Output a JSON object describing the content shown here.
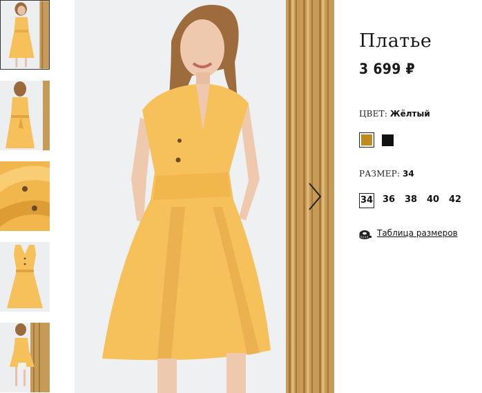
{
  "product": {
    "title": "Платье",
    "price": "3 699 ₽"
  },
  "color": {
    "label": "ЦВЕТ:",
    "selected_value": "Жёлтый",
    "swatches": [
      {
        "name": "yellow",
        "color": "#c08a1e",
        "selected": true
      },
      {
        "name": "black",
        "color": "#111111",
        "selected": false
      }
    ]
  },
  "size": {
    "label": "РАЗМЕР:",
    "selected_value": "34",
    "options": [
      "34",
      "36",
      "38",
      "40",
      "42"
    ]
  },
  "size_table": {
    "icon": "measuring-tape-icon",
    "link_text": "Таблица размеров"
  },
  "gallery": {
    "thumbnail_count": 5,
    "active_thumbnail": 1,
    "next_icon": "chevron-right-icon"
  },
  "colors": {
    "dress": "#f6c15b",
    "dress_shadow": "#e2a43e",
    "background": "#eef0f2",
    "bamboo": "#c69a57"
  }
}
